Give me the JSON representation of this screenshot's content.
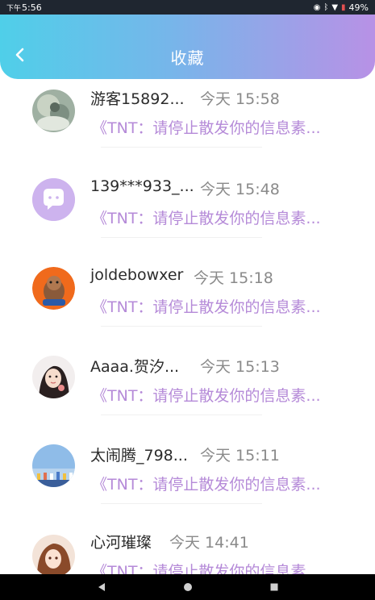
{
  "status_bar": {
    "time_prefix": "下午",
    "time": "5:56",
    "battery": "49%"
  },
  "header": {
    "title": "收藏",
    "gradient_start": "#4fcfe9",
    "gradient_end": "#b891e6"
  },
  "items": [
    {
      "name": "游客15892...",
      "time": "今天 15:58",
      "preview": "《TNT：请停止散发你的信息素...",
      "avatar": "photo-avatar"
    },
    {
      "name": "139***933_...",
      "time": "今天 15:48",
      "preview": "《TNT：请停止散发你的信息素...",
      "avatar": "chat-bubble-avatar"
    },
    {
      "name": "joldebowxer",
      "time": "今天 15:18",
      "preview": "《TNT：请停止散发你的信息素...",
      "avatar": "cartoon-avatar"
    },
    {
      "name": "Aaaa.贺汐...",
      "time": "今天 15:13",
      "preview": "《TNT：请停止散发你的信息素...",
      "avatar": "girl-avatar"
    },
    {
      "name": "太闹腾_798...",
      "time": "今天 15:11",
      "preview": "《TNT：请停止散发你的信息素...",
      "avatar": "sky-avatar"
    },
    {
      "name": "心河璀璨",
      "time": "今天 14:41",
      "preview": "《TNT：请停止散发你的信息素...",
      "avatar": "anime-girl-avatar"
    }
  ],
  "colors": {
    "preview_text": "#b58ad8",
    "name_text": "#2b2b2b",
    "time_text": "#8a8a8a"
  },
  "nav_bar": {
    "buttons": [
      "back-triangle-icon",
      "home-circle-icon",
      "recents-square-icon"
    ]
  }
}
